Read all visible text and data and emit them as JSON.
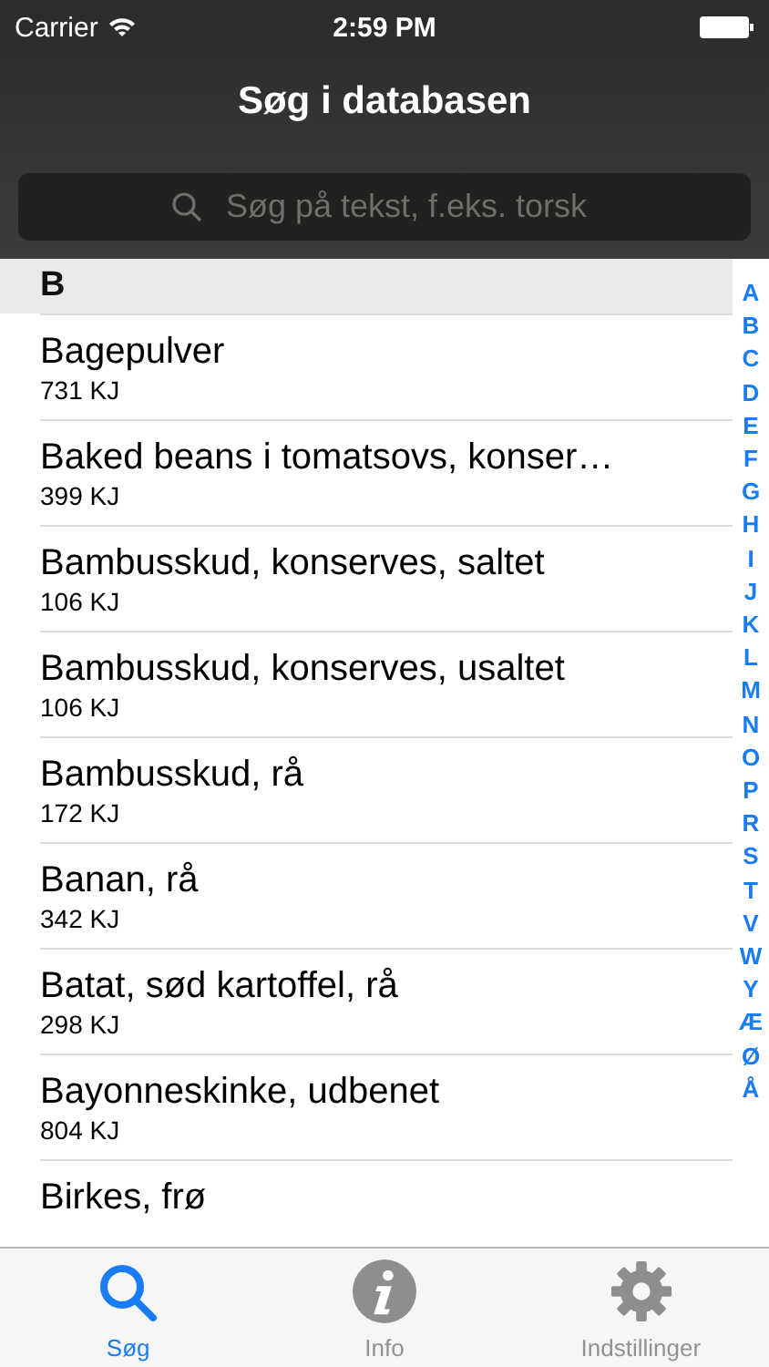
{
  "status_bar": {
    "carrier": "Carrier",
    "time": "2:59 PM"
  },
  "nav": {
    "title": "Søg i databasen"
  },
  "search": {
    "placeholder": "Søg på tekst, f.eks. torsk"
  },
  "section": {
    "title": "B"
  },
  "items": [
    {
      "name": "Bagepulver",
      "energy": "731 KJ"
    },
    {
      "name": "Baked beans i tomatsovs, konser…",
      "energy": "399 KJ"
    },
    {
      "name": "Bambusskud, konserves, saltet",
      "energy": "106 KJ"
    },
    {
      "name": "Bambusskud, konserves, usaltet",
      "energy": "106 KJ"
    },
    {
      "name": "Bambusskud, rå",
      "energy": "172 KJ"
    },
    {
      "name": "Banan, rå",
      "energy": "342 KJ"
    },
    {
      "name": "Batat, sød kartoffel, rå",
      "energy": "298 KJ"
    },
    {
      "name": "Bayonneskinke, udbenet",
      "energy": "804 KJ"
    },
    {
      "name": "Birkes, frø"
    }
  ],
  "index": [
    "A",
    "B",
    "C",
    "D",
    "E",
    "F",
    "G",
    "H",
    "I",
    "J",
    "K",
    "L",
    "M",
    "N",
    "O",
    "P",
    "R",
    "S",
    "T",
    "V",
    "W",
    "Y",
    "Æ",
    "Ø",
    "Å"
  ],
  "tabs": [
    {
      "label": "Søg",
      "kind": "search",
      "selected": true
    },
    {
      "label": "Info",
      "kind": "info",
      "selected": false
    },
    {
      "label": "Indstillinger",
      "kind": "settings",
      "selected": false
    }
  ]
}
